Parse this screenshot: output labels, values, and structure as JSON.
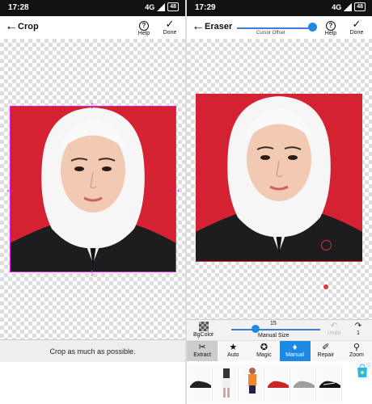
{
  "left": {
    "status": {
      "time": "17:28",
      "network": "4G",
      "battery": "48"
    },
    "toolbar": {
      "title": "Crop",
      "help": "Help",
      "done": "Done"
    },
    "hint": "Crop as much as possible."
  },
  "right": {
    "status": {
      "time": "17:29",
      "network": "4G",
      "battery": "48"
    },
    "toolbar": {
      "title": "Eraser",
      "cursor_offset_label": "Cursor Offset",
      "help": "Help",
      "done": "Done"
    },
    "controls": {
      "bgcolor": "BgColor",
      "size_value": "15",
      "size_label": "Manual Size",
      "undo": "Undo",
      "redo_count": "1"
    },
    "tools": [
      {
        "label": "Extract",
        "icon": "scissors-icon"
      },
      {
        "label": "Auto",
        "icon": "star-icon"
      },
      {
        "label": "Magic",
        "icon": "magic-star-icon"
      },
      {
        "label": "Manual",
        "icon": "eraser-icon"
      },
      {
        "label": "Repair",
        "icon": "brush-icon"
      },
      {
        "label": "Zoom",
        "icon": "search-icon"
      }
    ]
  },
  "colors": {
    "accent": "#1e88e5",
    "crop_handle": "#e020e0",
    "photo_bg": "#d42232"
  }
}
